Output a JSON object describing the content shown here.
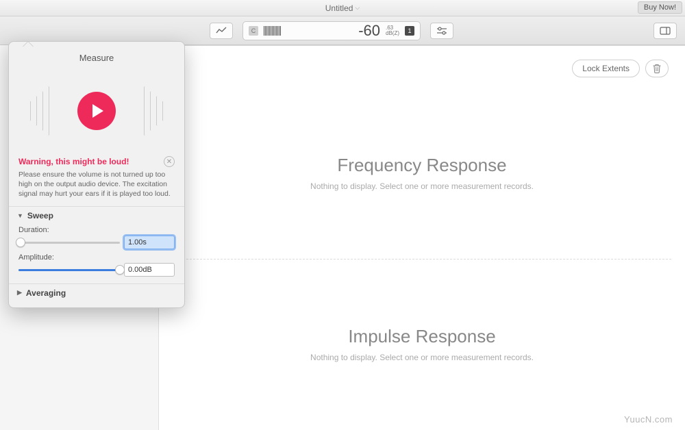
{
  "titlebar": {
    "document_title": "Untitled",
    "buy_now": "Buy Now!"
  },
  "toolbar": {
    "meter": {
      "channel_badge": "C",
      "reading": "-60",
      "unit_top": ".63",
      "unit_bottom": "dB(Z)",
      "count_badge": "1"
    }
  },
  "actions": {
    "lock_extents": "Lock Extents"
  },
  "charts": {
    "freq": {
      "title": "Frequency Response",
      "subtitle": "Nothing to display. Select one or more measurement records."
    },
    "impulse": {
      "title": "Impulse Response",
      "subtitle": "Nothing to display. Select one or more measurement records."
    }
  },
  "popover": {
    "title": "Measure",
    "warning_title": "Warning, this might be loud!",
    "warning_body": "Please ensure the volume is not turned up too high on the output audio device. The excitation signal may hurt your ears if it is played too loud.",
    "sections": {
      "sweep": {
        "label": "Sweep",
        "duration_label": "Duration:",
        "duration_value": "1.00s",
        "duration_fill_pct": 2,
        "amplitude_label": "Amplitude:",
        "amplitude_value": "0.00dB",
        "amplitude_fill_pct": 100
      },
      "averaging": {
        "label": "Averaging"
      }
    }
  },
  "watermark": "YuucN.com"
}
